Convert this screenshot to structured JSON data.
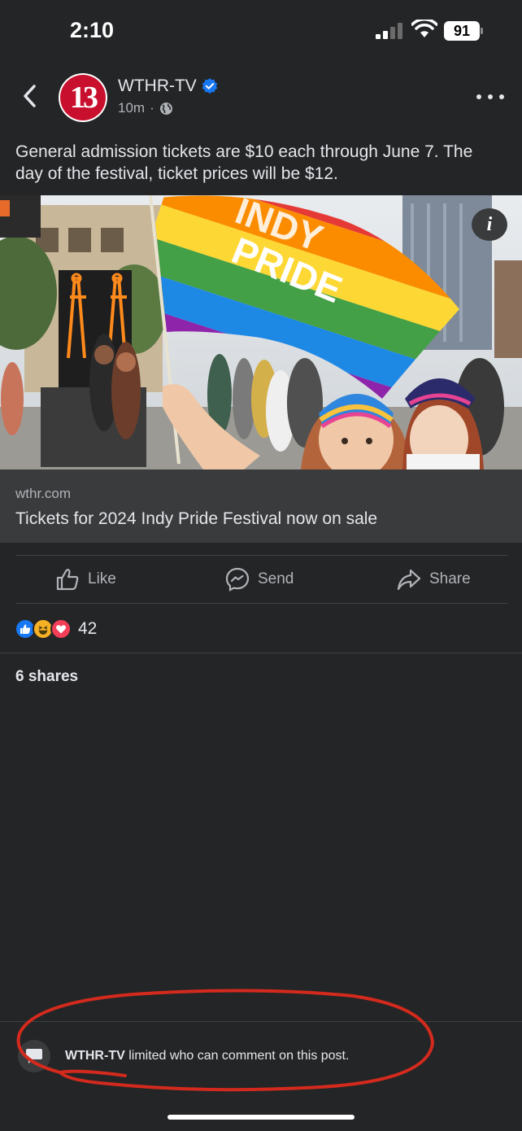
{
  "status_bar": {
    "time": "2:10",
    "battery": "91"
  },
  "header": {
    "avatar_text": "13",
    "page_name": "WTHR-TV",
    "time_ago": "10m",
    "dot": "·"
  },
  "post": {
    "text": "General admission tickets are $10 each through June 7. The day of the festival, ticket prices will be $12.",
    "image_flag_text_1": "INDY",
    "image_flag_text_2": "PRIDE"
  },
  "link_preview": {
    "domain": "wthr.com",
    "title": "Tickets for 2024 Indy Pride Festival now on sale"
  },
  "actions": {
    "like": "Like",
    "send": "Send",
    "share": "Share"
  },
  "reactions": {
    "types": [
      "like-icon",
      "haha-icon",
      "love-icon"
    ],
    "count": "42"
  },
  "shares": "6 shares",
  "comment_notice": {
    "page": "WTHR-TV",
    "message": " limited who can comment on this post."
  },
  "colors": {
    "background": "#242526",
    "surface": "#3a3b3c",
    "accent_blue": "#1877f2",
    "annotation_red": "#d42a1e"
  }
}
